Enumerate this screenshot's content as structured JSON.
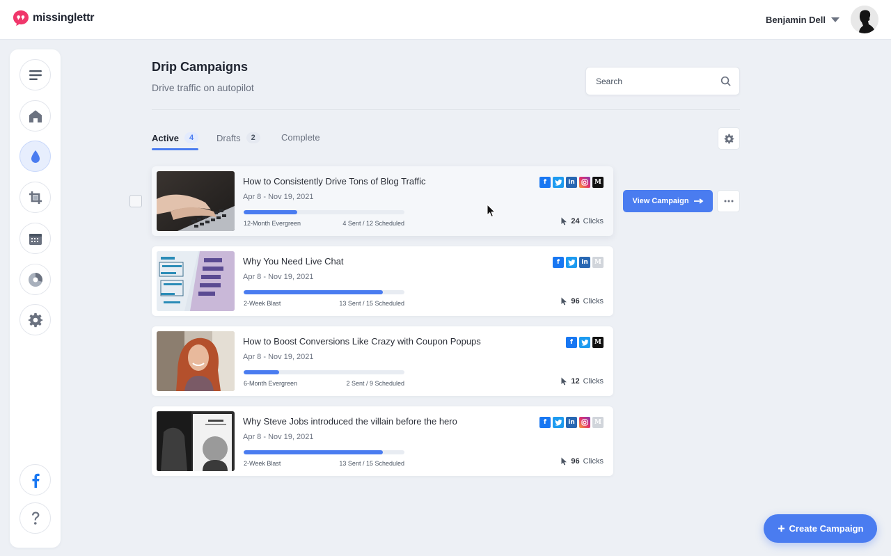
{
  "brand": {
    "name": "missinglettr",
    "icon": "quote-bubble-logo",
    "color": "#f0376b"
  },
  "user": {
    "name": "Benjamin Dell",
    "icon": "caret-down-icon"
  },
  "sidebar": {
    "items": [
      {
        "name": "menu",
        "icon": "hamburger-icon"
      },
      {
        "name": "home",
        "icon": "home-icon"
      },
      {
        "name": "drip-campaigns",
        "icon": "drop-icon",
        "active": true
      },
      {
        "name": "curate",
        "icon": "crop-cycle-icon"
      },
      {
        "name": "calendar",
        "icon": "calendar-icon"
      },
      {
        "name": "analytics",
        "icon": "pie-chart-icon"
      },
      {
        "name": "settings",
        "icon": "gear-icon"
      }
    ],
    "bottom": [
      {
        "name": "facebook-group",
        "icon": "facebook-icon"
      },
      {
        "name": "help",
        "icon": "question-icon"
      }
    ]
  },
  "header": {
    "title": "Drip Campaigns",
    "subtitle": "Drive traffic on autopilot"
  },
  "search": {
    "placeholder": "Search",
    "icon": "search-icon"
  },
  "tabs": [
    {
      "label": "Active",
      "count": "4",
      "active": true
    },
    {
      "label": "Drafts",
      "count": "2"
    },
    {
      "label": "Complete",
      "count": ""
    }
  ],
  "campaigns": [
    {
      "title": "How to Consistently Drive Tons of Blog Traffic",
      "dates": "Apr 8 - Nov 19, 2021",
      "progress": 0.333,
      "type": "12-Month Evergreen",
      "schedule": "4 Sent / 12 Scheduled",
      "clicks": "24",
      "clicks_label": "Clicks",
      "socials": [
        "facebook",
        "twitter",
        "linkedin",
        "instagram",
        "medium"
      ]
    },
    {
      "title": "Why You Need Live Chat",
      "dates": "Apr 8 - Nov 19, 2021",
      "progress": 0.867,
      "type": "2-Week Blast",
      "schedule": "13 Sent / 15 Scheduled",
      "clicks": "96",
      "clicks_label": "Clicks",
      "socials": [
        "facebook",
        "twitter",
        "linkedin",
        "medium-disabled"
      ]
    },
    {
      "title": "How to Boost Conversions Like Crazy with Coupon Popups",
      "dates": "Apr 8 - Nov 19, 2021",
      "progress": 0.222,
      "type": "6-Month Evergreen",
      "schedule": "2 Sent / 9 Scheduled",
      "clicks": "12",
      "clicks_label": "Clicks",
      "socials": [
        "facebook",
        "twitter",
        "medium"
      ]
    },
    {
      "title": "Why Steve Jobs introduced the villain before the hero",
      "dates": "Apr 8 - Nov 19, 2021",
      "progress": 0.867,
      "type": "2-Week Blast",
      "schedule": "13 Sent / 15 Scheduled",
      "clicks": "96",
      "clicks_label": "Clicks",
      "socials": [
        "facebook",
        "twitter",
        "linkedin",
        "instagram",
        "medium-disabled"
      ]
    }
  ],
  "actions": {
    "view_campaign": "View Campaign",
    "create_campaign": "Create Campaign"
  },
  "colors": {
    "accent": "#4a7cf0",
    "background": "#edf0f5"
  }
}
